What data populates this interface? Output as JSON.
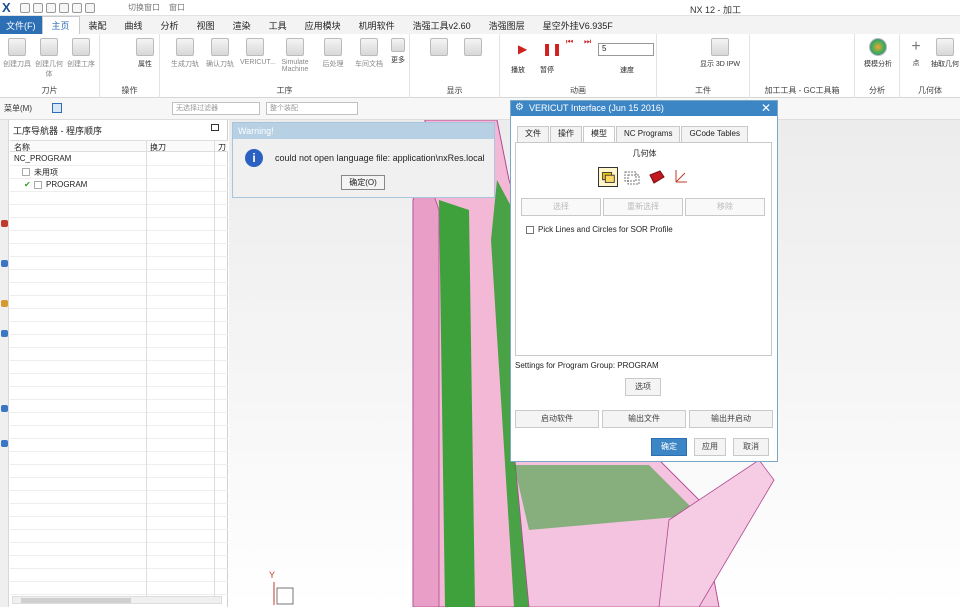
{
  "window_title": "NX 12 - 加工",
  "quick_access": {
    "switch_window": "切换窗口",
    "window_menu": "窗口"
  },
  "menu": {
    "file": "文件(F)",
    "tabs": [
      "主页",
      "装配",
      "曲线",
      "分析",
      "视图",
      "渲染",
      "工具",
      "应用模块",
      "机明软件",
      "浩强工具v2.60",
      "浩强图层",
      "星空外挂V6.935F"
    ],
    "active_tab": "主页"
  },
  "ribbon": {
    "groups": {
      "tool": "刀片",
      "operation": "操作",
      "process": "工序",
      "display": "显示",
      "animation": "动画",
      "work": "工件",
      "gc_tools": "加工工具 - GC工具箱",
      "analysis": "分析",
      "geometry": "几何体"
    },
    "buttons": {
      "create_tool": "创建刀具",
      "create_geometry": "创建几何体",
      "create_op": "创建工序",
      "properties": "属性",
      "generate_toolpath": "生成刀轨",
      "verify_toolpath": "确认刀轨",
      "vericut": "VERICUT...",
      "simulate_machine": "Simulate Machine",
      "post_process": "后处理",
      "shop_doc": "车间文档",
      "more": "更多",
      "play": "播放",
      "pause": "暂停",
      "speed": "速度",
      "speed_value": "5",
      "show_3d_ipw": "显示 3D IPW",
      "mold_analysis": "模模分析",
      "point": "点",
      "extract_geometry": "抽取几何"
    }
  },
  "toolbar2": {
    "menu": "菜单(M)",
    "filter_placeholder": "无选择过滤器",
    "assembly_placeholder": "整个装配"
  },
  "navigator": {
    "title": "工序导航器 - 程序顺序",
    "col_name": "名称",
    "col_tool_change": "换刀",
    "col_path": "刀",
    "rows": [
      {
        "name": "NC_PROGRAM"
      },
      {
        "name": "未用项"
      },
      {
        "name": "PROGRAM"
      }
    ]
  },
  "warning": {
    "title": "Warning!",
    "message": "could not open language file: application\\nxRes.local",
    "ok": "确定(O)"
  },
  "vericut": {
    "title": "VERICUT Interface (Jun 15 2016)",
    "tabs": [
      "文件",
      "操作",
      "模型",
      "NC Programs",
      "GCode Tables"
    ],
    "active_tab": "模型",
    "section": "几何体",
    "select": "选择",
    "reselect": "重新选择",
    "remove": "移除",
    "checkbox": "Pick Lines and Circles for SOR Profile",
    "settings": "Settings for Program Group: PROGRAM",
    "options": "选项",
    "launch": "启动软件",
    "export": "输出文件",
    "export_launch": "输出并启动",
    "ok": "确定",
    "apply": "应用",
    "cancel": "取消"
  }
}
